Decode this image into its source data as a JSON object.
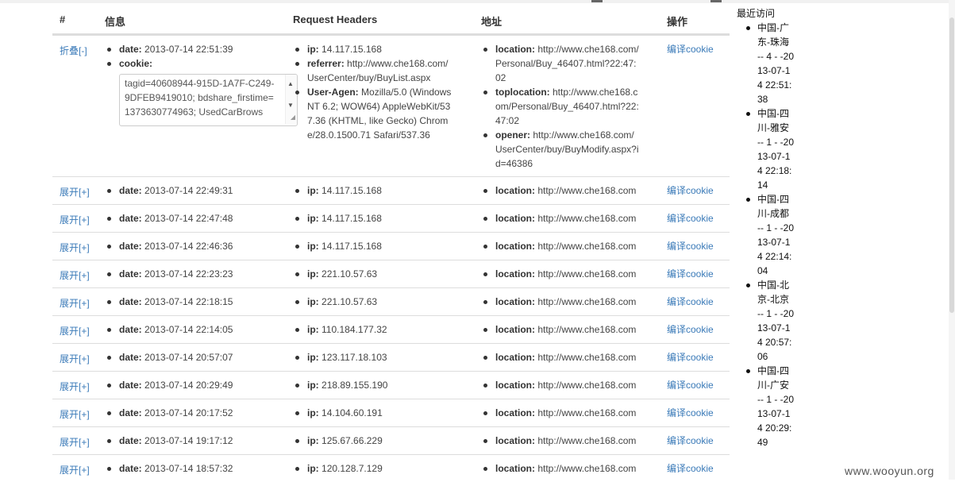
{
  "headers": {
    "num": "#",
    "info": "信息",
    "req": "Request Headers",
    "addr": "地址",
    "op": "操作"
  },
  "expanded": {
    "toggle": "折叠[-]",
    "date_label": "date:",
    "date": "2013-07-14 22:51:39",
    "cookie_label": "cookie:",
    "cookie_value": "tagid=40608944-915D-1A7F-C249-9DFEB9419010; bdshare_firstime=1373630774963; UsedCarBrows",
    "ip_label": "ip:",
    "ip": "14.117.15.168",
    "referrer_label": "referrer:",
    "referrer": "http://www.che168.com/UserCenter/buy/BuyList.aspx",
    "ua_label": "User-Agen:",
    "ua": "Mozilla/5.0 (Windows NT 6.2; WOW64) AppleWebKit/537.36 (KHTML, like Gecko) Chrome/28.0.1500.71 Safari/537.36",
    "location_label": "location:",
    "location": "http://www.che168.com/Personal/Buy_46407.html?22:47:02",
    "toplocation_label": "toplocation:",
    "toplocation": "http://www.che168.com/Personal/Buy_46407.html?22:47:02",
    "opener_label": "opener:",
    "opener": "http://www.che168.com/UserCenter/buy/BuyModify.aspx?id=46386",
    "op": "编译cookie"
  },
  "labels": {
    "date": "date:",
    "ip": "ip:",
    "location": "location:"
  },
  "rows": [
    {
      "toggle": "展开[+]",
      "date": "2013-07-14 22:49:31",
      "ip": "14.117.15.168",
      "location": "http://www.che168.com",
      "op": "编译cookie"
    },
    {
      "toggle": "展开[+]",
      "date": "2013-07-14 22:47:48",
      "ip": "14.117.15.168",
      "location": "http://www.che168.com",
      "op": "编译cookie"
    },
    {
      "toggle": "展开[+]",
      "date": "2013-07-14 22:46:36",
      "ip": "14.117.15.168",
      "location": "http://www.che168.com",
      "op": "编译cookie"
    },
    {
      "toggle": "展开[+]",
      "date": "2013-07-14 22:23:23",
      "ip": "221.10.57.63",
      "location": "http://www.che168.com",
      "op": "编译cookie"
    },
    {
      "toggle": "展开[+]",
      "date": "2013-07-14 22:18:15",
      "ip": "221.10.57.63",
      "location": "http://www.che168.com",
      "op": "编译cookie"
    },
    {
      "toggle": "展开[+]",
      "date": "2013-07-14 22:14:05",
      "ip": "110.184.177.32",
      "location": "http://www.che168.com",
      "op": "编译cookie"
    },
    {
      "toggle": "展开[+]",
      "date": "2013-07-14 20:57:07",
      "ip": "123.117.18.103",
      "location": "http://www.che168.com",
      "op": "编译cookie"
    },
    {
      "toggle": "展开[+]",
      "date": "2013-07-14 20:29:49",
      "ip": "218.89.155.190",
      "location": "http://www.che168.com",
      "op": "编译cookie"
    },
    {
      "toggle": "展开[+]",
      "date": "2013-07-14 20:17:52",
      "ip": "14.104.60.191",
      "location": "http://www.che168.com",
      "op": "编译cookie"
    },
    {
      "toggle": "展开[+]",
      "date": "2013-07-14 19:17:12",
      "ip": "125.67.66.229",
      "location": "http://www.che168.com",
      "op": "编译cookie"
    },
    {
      "toggle": "展开[+]",
      "date": "2013-07-14 18:57:32",
      "ip": "120.128.7.129",
      "location": "http://www.che168.com",
      "op": "编译cookie"
    }
  ],
  "sidebar": {
    "title": "最近访问",
    "items": [
      "中国-广东-珠海 -- 4 - -2013-07-14 22:51:38",
      "中国-四川-雅安 -- 1 - -2013-07-14 22:18:14",
      "中国-四川-成都 -- 1 - -2013-07-14 22:14:04",
      "中国-北京-北京 -- 1 - -2013-07-14 20:57:06",
      "中国-四川-广安 -- 1 - -2013-07-14 20:29:49"
    ]
  },
  "watermark": "www.wooyun.org",
  "colors": {
    "link": "#3a7ab8",
    "border": "#dddddd",
    "text": "#333333"
  }
}
